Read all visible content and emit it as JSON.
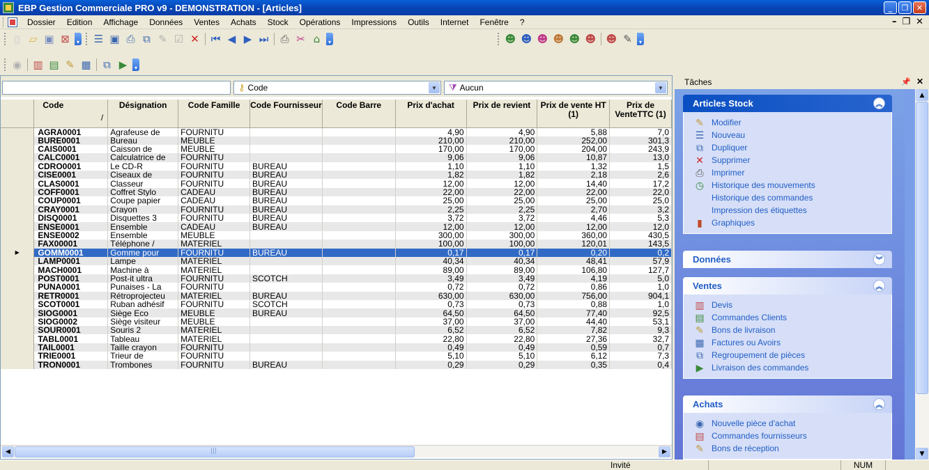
{
  "window": {
    "title": "EBP Gestion Commerciale PRO v9 - DEMONSTRATION - [Articles]"
  },
  "menu": [
    "Dossier",
    "Edition",
    "Affichage",
    "Données",
    "Ventes",
    "Achats",
    "Stock",
    "Opérations",
    "Impressions",
    "Outils",
    "Internet",
    "Fenêtre",
    "?"
  ],
  "filter": {
    "search_value": "",
    "sort_field": "Code",
    "filter_field": "Aucun"
  },
  "grid": {
    "columns": [
      "Code",
      "Désignation",
      "Code Famille",
      "Code Fournisseur",
      "Code Barre",
      "Prix d'achat",
      "Prix de revient",
      "Prix de vente HT (1)",
      "Prix de VenteTTC (1)"
    ],
    "sort_indicator": "/",
    "selected_index": 14,
    "rows": [
      [
        "AGRA0001",
        "Agrafeuse de",
        "FOURNITU",
        "",
        "",
        "4,90",
        "4,90",
        "5,88",
        "7,0"
      ],
      [
        "BURE0001",
        "Bureau",
        "MEUBLE",
        "",
        "",
        "210,00",
        "210,00",
        "252,00",
        "301,3"
      ],
      [
        "CAIS0001",
        "Caisson de",
        "MEUBLE",
        "",
        "",
        "170,00",
        "170,00",
        "204,00",
        "243,9"
      ],
      [
        "CALC0001",
        "Calculatrice de",
        "FOURNITU",
        "",
        "",
        "9,06",
        "9,06",
        "10,87",
        "13,0"
      ],
      [
        "CDRO0001",
        "Le CD-R",
        "FOURNITU",
        "BUREAU",
        "",
        "1,10",
        "1,10",
        "1,32",
        "1,5"
      ],
      [
        "CISE0001",
        "Ciseaux de",
        "FOURNITU",
        "BUREAU",
        "",
        "1,82",
        "1,82",
        "2,18",
        "2,6"
      ],
      [
        "CLAS0001",
        "Classeur",
        "FOURNITU",
        "BUREAU",
        "",
        "12,00",
        "12,00",
        "14,40",
        "17,2"
      ],
      [
        "COFF0001",
        "Coffret Stylo",
        "CADEAU",
        "BUREAU",
        "",
        "22,00",
        "22,00",
        "22,00",
        "22,0"
      ],
      [
        "COUP0001",
        "Coupe papier",
        "CADEAU",
        "BUREAU",
        "",
        "25,00",
        "25,00",
        "25,00",
        "25,0"
      ],
      [
        "CRAY0001",
        "Crayon",
        "FOURNITU",
        "BUREAU",
        "",
        "2,25",
        "2,25",
        "2,70",
        "3,2"
      ],
      [
        "DISQ0001",
        "Disquettes 3",
        "FOURNITU",
        "BUREAU",
        "",
        "3,72",
        "3,72",
        "4,46",
        "5,3"
      ],
      [
        "ENSE0001",
        "Ensemble",
        "CADEAU",
        "BUREAU",
        "",
        "12,00",
        "12,00",
        "12,00",
        "12,0"
      ],
      [
        "ENSE0002",
        "Ensemble",
        "MEUBLE",
        "",
        "",
        "300,00",
        "300,00",
        "360,00",
        "430,5"
      ],
      [
        "FAX00001",
        "Téléphone /",
        "MATERIEL",
        "",
        "",
        "100,00",
        "100,00",
        "120,01",
        "143,5"
      ],
      [
        "GOMM0001",
        "Gomme pour",
        "FOURNITU",
        "BUREAU",
        "",
        "0,17",
        "0,17",
        "0,20",
        "0,2"
      ],
      [
        "LAMP0001",
        "Lampe",
        "MATERIEL",
        "",
        "",
        "40,34",
        "40,34",
        "48,41",
        "57,9"
      ],
      [
        "MACH0001",
        "Machine à",
        "MATERIEL",
        "",
        "",
        "89,00",
        "89,00",
        "106,80",
        "127,7"
      ],
      [
        "POST0001",
        "Post-it ultra",
        "FOURNITU",
        "SCOTCH",
        "",
        "3,49",
        "3,49",
        "4,19",
        "5,0"
      ],
      [
        "PUNA0001",
        "Punaises - La",
        "FOURNITU",
        "",
        "",
        "0,72",
        "0,72",
        "0,86",
        "1,0"
      ],
      [
        "RETR0001",
        "Rétroprojecteu",
        "MATERIEL",
        "BUREAU",
        "",
        "630,00",
        "630,00",
        "756,00",
        "904,1"
      ],
      [
        "SCOT0001",
        "Ruban adhésif",
        "FOURNITU",
        "SCOTCH",
        "",
        "0,73",
        "0,73",
        "0,88",
        "1,0"
      ],
      [
        "SIOG0001",
        "Siège Eco",
        "MEUBLE",
        "BUREAU",
        "",
        "64,50",
        "64,50",
        "77,40",
        "92,5"
      ],
      [
        "SIOG0002",
        "Siège visiteur",
        "MEUBLE",
        "",
        "",
        "37,00",
        "37,00",
        "44,40",
        "53,1"
      ],
      [
        "SOUR0001",
        "Souris 2",
        "MATERIEL",
        "",
        "",
        "6,52",
        "6,52",
        "7,82",
        "9,3"
      ],
      [
        "TABL0001",
        "Tableau",
        "MATERIEL",
        "",
        "",
        "22,80",
        "22,80",
        "27,36",
        "32,7"
      ],
      [
        "TAIL0001",
        "Taille crayon",
        "FOURNITU",
        "",
        "",
        "0,49",
        "0,49",
        "0,59",
        "0,7"
      ],
      [
        "TRIE0001",
        "Trieur de",
        "FOURNITU",
        "",
        "",
        "5,10",
        "5,10",
        "6,12",
        "7,3"
      ],
      [
        "TRON0001",
        "Trombones",
        "FOURNITU",
        "BUREAU",
        "",
        "0,29",
        "0,29",
        "0,35",
        "0,4"
      ]
    ]
  },
  "taskpane": {
    "title": "Tâches",
    "groups": [
      {
        "title": "Articles Stock",
        "expanded": true,
        "items": [
          {
            "label": "Modifier",
            "icon": "edit-icon"
          },
          {
            "label": "Nouveau",
            "icon": "new-icon"
          },
          {
            "label": "Dupliquer",
            "icon": "duplicate-icon"
          },
          {
            "label": "Supprimer",
            "icon": "delete-icon"
          },
          {
            "label": "Imprimer",
            "icon": "print-icon"
          },
          {
            "label": "Historique des mouvements",
            "icon": "history-icon"
          },
          {
            "label": "Historique des commandes",
            "icon": ""
          },
          {
            "label": "Impression des étiquettes",
            "icon": ""
          },
          {
            "label": "Graphiques",
            "icon": "chart-icon"
          }
        ]
      },
      {
        "title": "Données",
        "expanded": false,
        "items": []
      },
      {
        "title": "Ventes",
        "expanded": true,
        "items": [
          {
            "label": "Devis",
            "icon": "quote-icon"
          },
          {
            "label": "Commandes Clients",
            "icon": "customer-order-icon"
          },
          {
            "label": "Bons de livraison",
            "icon": "delivery-note-icon"
          },
          {
            "label": "Factures ou Avoirs",
            "icon": "invoice-icon"
          },
          {
            "label": "Regroupement de pièces",
            "icon": "group-documents-icon"
          },
          {
            "label": "Livraison des commandes",
            "icon": "order-delivery-icon"
          }
        ]
      },
      {
        "title": "Achats",
        "expanded": true,
        "items": [
          {
            "label": "Nouvelle pièce d'achat",
            "icon": "new-purchase-icon"
          },
          {
            "label": "Commandes fournisseurs",
            "icon": "supplier-order-icon"
          },
          {
            "label": "Bons de réception",
            "icon": "receipt-note-icon"
          }
        ]
      }
    ]
  },
  "status": {
    "user": "Invité",
    "numlock": "NUM"
  },
  "colors": {
    "selection": "#316ac5",
    "title_bar": "#0a4fc2",
    "task_pane_bg": "#7ba2e7",
    "task_link": "#215dc6"
  }
}
